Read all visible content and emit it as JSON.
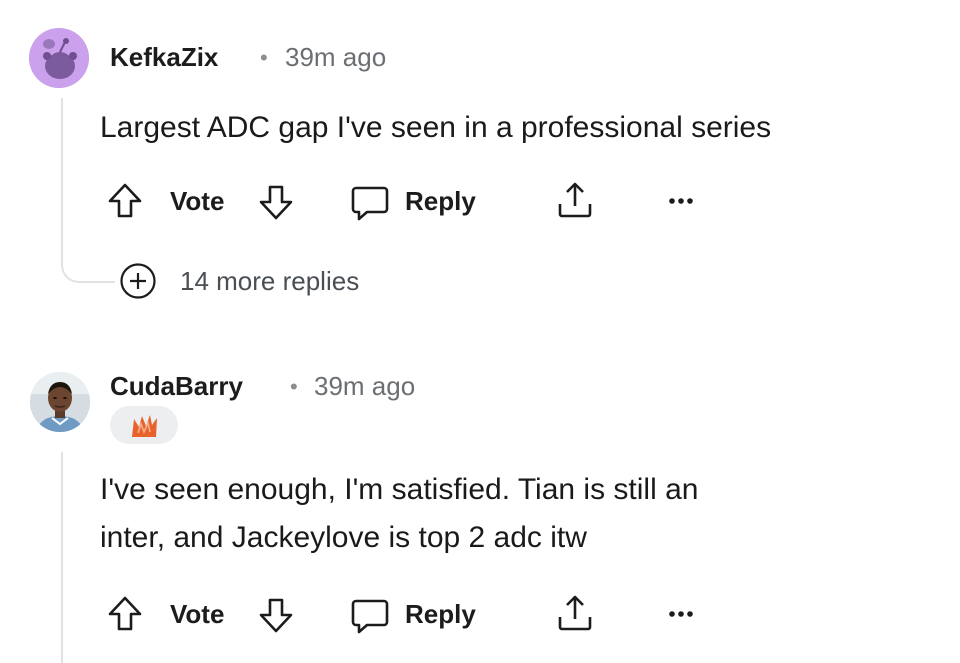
{
  "comments": [
    {
      "username": "KefkaZix",
      "separator": "•",
      "time": "39m ago",
      "avatar_icon": "snoo-avatar-icon",
      "avatar_color": "#cba0ec",
      "body_lines": [
        "Largest ADC gap I've seen in a professional series"
      ],
      "actions": {
        "vote": "Vote",
        "reply": "Reply"
      },
      "more_replies": "14 more replies"
    },
    {
      "username": "CudaBarry",
      "separator": "•",
      "time": "39m ago",
      "avatar_icon": "user-photo-avatar",
      "flair_icon": "team-flair-icon",
      "flair_color": "#e8632b",
      "body_lines": [
        "I've seen enough, I'm satisfied. Tian is still an",
        "inter, and Jackeylove is top 2 adc itw"
      ],
      "actions": {
        "vote": "Vote",
        "reply": "Reply"
      }
    }
  ],
  "colors": {
    "thread_line": "#dfe3e6",
    "text_primary": "#1a1a1b",
    "text_meta": "#6b6f73"
  }
}
